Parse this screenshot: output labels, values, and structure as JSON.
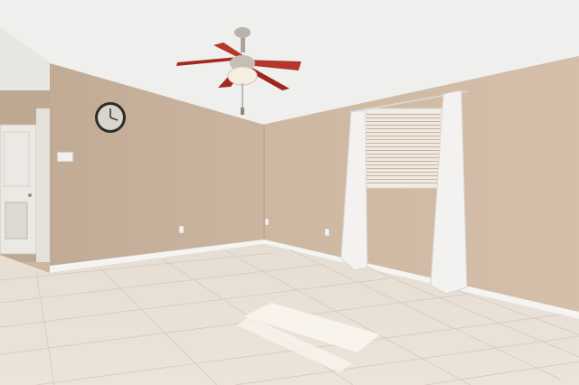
{
  "scene": {
    "description_label": "",
    "colors": {
      "ceiling": "#efefee",
      "wall_left": "#c9b39d",
      "wall_right": "#d2bca6",
      "wall_shadow": "#b8a38e",
      "baseboard": "#f4f4f2",
      "floor": "#e9dfd4",
      "floor_grout": "#d4c8bb",
      "door": "#ece9e4",
      "curtain": "#f3f2f0",
      "fan_blade": "#b5362a",
      "fan_metal": "#b9b3ad",
      "clock_face": "#d9d4cc",
      "sunlight": "#fbf7ef"
    },
    "objects": [
      "ceiling-fan",
      "wall-clock",
      "thermostat",
      "door",
      "window-blinds",
      "curtain-left",
      "curtain-right",
      "outlet",
      "tile-floor"
    ]
  }
}
